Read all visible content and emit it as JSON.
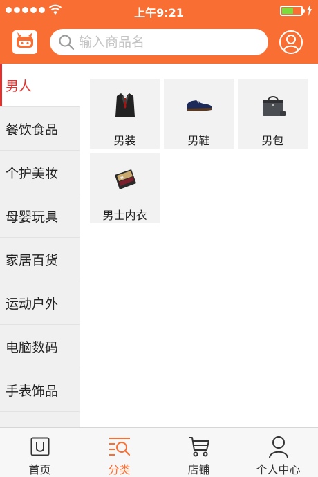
{
  "status_bar": {
    "time": "上午9:21",
    "battery_level": 0.6
  },
  "search": {
    "placeholder": "输入商品名"
  },
  "sidebar": {
    "items": [
      {
        "label": "男人",
        "active": true
      },
      {
        "label": "餐饮食品"
      },
      {
        "label": "个护美妆"
      },
      {
        "label": "母婴玩具"
      },
      {
        "label": "家居百货"
      },
      {
        "label": "运动户外"
      },
      {
        "label": "电脑数码"
      },
      {
        "label": "手表饰品"
      }
    ]
  },
  "content": {
    "items": [
      {
        "label": "男装",
        "icon": "suit-icon"
      },
      {
        "label": "男鞋",
        "icon": "shoe-icon"
      },
      {
        "label": "男包",
        "icon": "bag-icon"
      },
      {
        "label": "男士内衣",
        "icon": "underwear-icon"
      }
    ]
  },
  "tabbar": {
    "items": [
      {
        "label": "首页",
        "icon": "home-icon"
      },
      {
        "label": "分类",
        "icon": "category-icon",
        "active": true
      },
      {
        "label": "店铺",
        "icon": "cart-icon"
      },
      {
        "label": "个人中心",
        "icon": "person-icon"
      }
    ]
  },
  "colors": {
    "brand": "#f96f33",
    "active_category": "#e3312d",
    "battery": "#7ddc3c"
  }
}
